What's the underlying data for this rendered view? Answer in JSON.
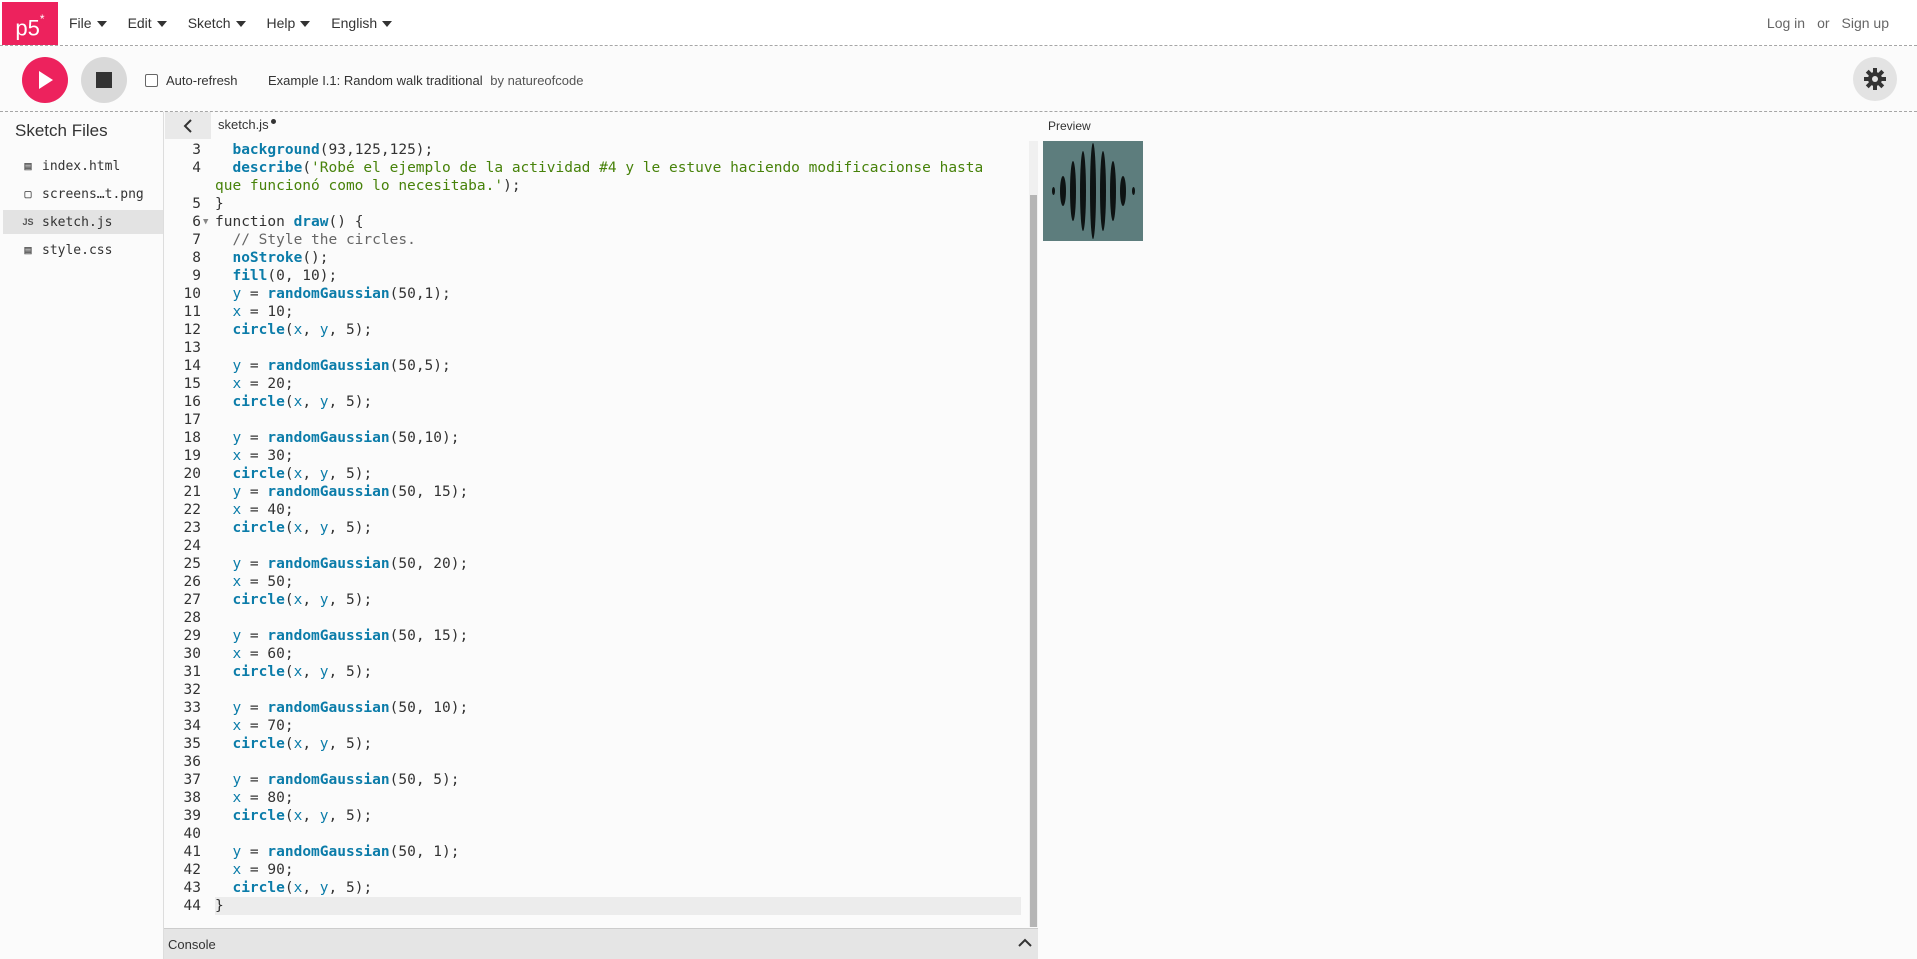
{
  "nav": {
    "logo": "p5",
    "logo_mark": "*",
    "menus": [
      "File",
      "Edit",
      "Sketch",
      "Help",
      "English"
    ],
    "login": "Log in",
    "or": "or",
    "signup": "Sign up"
  },
  "toolbar": {
    "auto_refresh_label": "Auto-refresh",
    "auto_refresh_checked": false,
    "project_name": "Example I.1: Random walk traditional",
    "by_label": "by natureofcode"
  },
  "sidebar": {
    "title": "Sketch Files",
    "files": [
      {
        "icon": "html-file-icon",
        "name": "index.html"
      },
      {
        "icon": "image-file-icon",
        "name": "screens…t.png"
      },
      {
        "icon": "js-file-icon",
        "name": "sketch.js",
        "active": true
      },
      {
        "icon": "css-file-icon",
        "name": "style.css"
      }
    ]
  },
  "editor": {
    "tab_name": "sketch.js",
    "tab_unsaved": true,
    "lines": [
      {
        "n": "3",
        "html": "  <span class=\"fn\">background</span>(93,125,125);"
      },
      {
        "n": "4",
        "html": "  <span class=\"fn\">describe</span>(<span class=\"str\">'Robé el ejemplo de la actividad #4 y le estuve haciendo modificacionse hasta</span>"
      },
      {
        "n": "",
        "html": "<span class=\"str\">que funcionó como lo necesitaba.'</span>);"
      },
      {
        "n": "5",
        "html": "}"
      },
      {
        "n": "6",
        "fold": true,
        "html": "function <span class=\"fn\">draw</span>() {"
      },
      {
        "n": "7",
        "html": "  <span class=\"com\">// Style the circles.</span>"
      },
      {
        "n": "8",
        "html": "  <span class=\"fn\">noStroke</span>();"
      },
      {
        "n": "9",
        "html": "  <span class=\"fn\">fill</span>(0, 10);"
      },
      {
        "n": "10",
        "html": "  <span class=\"var\">y</span> = <span class=\"fn\">randomGaussian</span>(50,1);"
      },
      {
        "n": "11",
        "html": "  <span class=\"var\">x</span> = 10;"
      },
      {
        "n": "12",
        "html": "  <span class=\"fn\">circle</span>(<span class=\"var\">x</span>, <span class=\"var\">y</span>, 5);"
      },
      {
        "n": "13",
        "html": ""
      },
      {
        "n": "14",
        "html": "  <span class=\"var\">y</span> = <span class=\"fn\">randomGaussian</span>(50,5);"
      },
      {
        "n": "15",
        "html": "  <span class=\"var\">x</span> = 20;"
      },
      {
        "n": "16",
        "html": "  <span class=\"fn\">circle</span>(<span class=\"var\">x</span>, <span class=\"var\">y</span>, 5);"
      },
      {
        "n": "17",
        "html": ""
      },
      {
        "n": "18",
        "html": "  <span class=\"var\">y</span> = <span class=\"fn\">randomGaussian</span>(50,10);"
      },
      {
        "n": "19",
        "html": "  <span class=\"var\">x</span> = 30;"
      },
      {
        "n": "20",
        "html": "  <span class=\"fn\">circle</span>(<span class=\"var\">x</span>, <span class=\"var\">y</span>, 5);"
      },
      {
        "n": "21",
        "html": "  <span class=\"var\">y</span> = <span class=\"fn\">randomGaussian</span>(50, 15);"
      },
      {
        "n": "22",
        "html": "  <span class=\"var\">x</span> = 40;"
      },
      {
        "n": "23",
        "html": "  <span class=\"fn\">circle</span>(<span class=\"var\">x</span>, <span class=\"var\">y</span>, 5);"
      },
      {
        "n": "24",
        "html": ""
      },
      {
        "n": "25",
        "html": "  <span class=\"var\">y</span> = <span class=\"fn\">randomGaussian</span>(50, 20);"
      },
      {
        "n": "26",
        "html": "  <span class=\"var\">x</span> = 50;"
      },
      {
        "n": "27",
        "html": "  <span class=\"fn\">circle</span>(<span class=\"var\">x</span>, <span class=\"var\">y</span>, 5);"
      },
      {
        "n": "28",
        "html": ""
      },
      {
        "n": "29",
        "html": "  <span class=\"var\">y</span> = <span class=\"fn\">randomGaussian</span>(50, 15);"
      },
      {
        "n": "30",
        "html": "  <span class=\"var\">x</span> = 60;"
      },
      {
        "n": "31",
        "html": "  <span class=\"fn\">circle</span>(<span class=\"var\">x</span>, <span class=\"var\">y</span>, 5);"
      },
      {
        "n": "32",
        "html": ""
      },
      {
        "n": "33",
        "html": "  <span class=\"var\">y</span> = <span class=\"fn\">randomGaussian</span>(50, 10);"
      },
      {
        "n": "34",
        "html": "  <span class=\"var\">x</span> = 70;"
      },
      {
        "n": "35",
        "html": "  <span class=\"fn\">circle</span>(<span class=\"var\">x</span>, <span class=\"var\">y</span>, 5);"
      },
      {
        "n": "36",
        "html": ""
      },
      {
        "n": "37",
        "html": "  <span class=\"var\">y</span> = <span class=\"fn\">randomGaussian</span>(50, 5);"
      },
      {
        "n": "38",
        "html": "  <span class=\"var\">x</span> = 80;"
      },
      {
        "n": "39",
        "html": "  <span class=\"fn\">circle</span>(<span class=\"var\">x</span>, <span class=\"var\">y</span>, 5);"
      },
      {
        "n": "40",
        "html": ""
      },
      {
        "n": "41",
        "html": "  <span class=\"var\">y</span> = <span class=\"fn\">randomGaussian</span>(50, 1);"
      },
      {
        "n": "42",
        "html": "  <span class=\"var\">x</span> = 90;"
      },
      {
        "n": "43",
        "html": "  <span class=\"fn\">circle</span>(<span class=\"var\">x</span>, <span class=\"var\">y</span>, 5);"
      },
      {
        "n": "44",
        "current": true,
        "html": "}"
      }
    ]
  },
  "console": {
    "label": "Console"
  },
  "preview": {
    "label": "Preview",
    "background": "#5d7d7d"
  },
  "colors": {
    "accent": "#ed225d",
    "function": "#0b7ca9",
    "string": "#47820a"
  }
}
